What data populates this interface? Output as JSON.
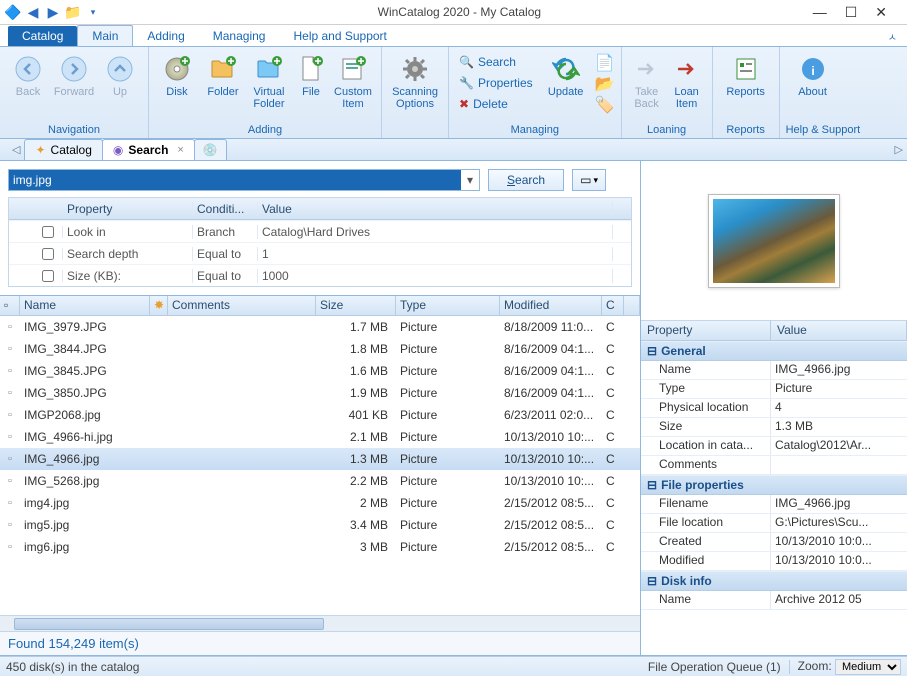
{
  "title": "WinCatalog 2020 - My Catalog",
  "ribbon_tabs": {
    "file": "Catalog",
    "main": "Main",
    "adding": "Adding",
    "managing": "Managing",
    "help": "Help and Support"
  },
  "ribbon": {
    "nav": {
      "back": "Back",
      "forward": "Forward",
      "up": "Up",
      "group": "Navigation"
    },
    "adding": {
      "disk": "Disk",
      "folder": "Folder",
      "vfolder": "Virtual\nFolder",
      "file": "File",
      "custom": "Custom\nItem",
      "group": "Adding"
    },
    "scan": {
      "label": "Scanning\nOptions"
    },
    "managing": {
      "search": "Search",
      "properties": "Properties",
      "delete": "Delete",
      "update": "Update",
      "group": "Managing"
    },
    "loaning": {
      "take": "Take\nBack",
      "loan": "Loan\nItem",
      "group": "Loaning"
    },
    "reports": {
      "label": "Reports",
      "group": "Reports"
    },
    "about": {
      "label": "About",
      "group": "Help & Support"
    }
  },
  "doctabs": {
    "catalog": "Catalog",
    "search": "Search"
  },
  "search": {
    "query": "img.jpg",
    "search_btn": "Search",
    "columns": {
      "property": "Property",
      "condition": "Conditi...",
      "value": "Value"
    },
    "rows": [
      {
        "property": "Look in",
        "condition": "Branch",
        "value": "Catalog\\Hard Drives"
      },
      {
        "property": "Search depth",
        "condition": "Equal to",
        "value": "1"
      },
      {
        "property": "Size (KB):",
        "condition": "Equal to",
        "value": "1000"
      }
    ]
  },
  "results": {
    "columns": {
      "name": "Name",
      "comments": "Comments",
      "size": "Size",
      "type": "Type",
      "modified": "Modified",
      "c": "C"
    },
    "rows": [
      {
        "name": "IMG_3979.JPG",
        "comments": "",
        "size": "1.7 MB",
        "type": "Picture",
        "modified": "8/18/2009 11:0...",
        "c": "C"
      },
      {
        "name": "IMG_3844.JPG",
        "comments": "",
        "size": "1.8 MB",
        "type": "Picture",
        "modified": "8/16/2009 04:1...",
        "c": "C"
      },
      {
        "name": "IMG_3845.JPG",
        "comments": "",
        "size": "1.6 MB",
        "type": "Picture",
        "modified": "8/16/2009 04:1...",
        "c": "C"
      },
      {
        "name": "IMG_3850.JPG",
        "comments": "",
        "size": "1.9 MB",
        "type": "Picture",
        "modified": "8/16/2009 04:1...",
        "c": "C"
      },
      {
        "name": "IMGP2068.jpg",
        "comments": "",
        "size": "401 KB",
        "type": "Picture",
        "modified": "6/23/2011 02:0...",
        "c": "C"
      },
      {
        "name": "IMG_4966-hi.jpg",
        "comments": "",
        "size": "2.1 MB",
        "type": "Picture",
        "modified": "10/13/2010 10:...",
        "c": "C"
      },
      {
        "name": "IMG_4966.jpg",
        "comments": "",
        "size": "1.3 MB",
        "type": "Picture",
        "modified": "10/13/2010 10:...",
        "c": "C",
        "sel": true
      },
      {
        "name": "IMG_5268.jpg",
        "comments": "",
        "size": "2.2 MB",
        "type": "Picture",
        "modified": "10/13/2010 10:...",
        "c": "C"
      },
      {
        "name": "img4.jpg",
        "comments": "",
        "size": "2 MB",
        "type": "Picture",
        "modified": "2/15/2012 08:5...",
        "c": "C"
      },
      {
        "name": "img5.jpg",
        "comments": "",
        "size": "3.4 MB",
        "type": "Picture",
        "modified": "2/15/2012 08:5...",
        "c": "C"
      },
      {
        "name": "img6.jpg",
        "comments": "",
        "size": "3 MB",
        "type": "Picture",
        "modified": "2/15/2012 08:5...",
        "c": "C"
      }
    ],
    "status": "Found 154,249 item(s)"
  },
  "properties": {
    "hdr": {
      "property": "Property",
      "value": "Value"
    },
    "general": {
      "title": "General",
      "rows": [
        {
          "k": "Name",
          "v": "IMG_4966.jpg"
        },
        {
          "k": "Type",
          "v": "Picture"
        },
        {
          "k": "Physical location",
          "v": "4"
        },
        {
          "k": "Size",
          "v": "1.3 MB"
        },
        {
          "k": "Location in cata...",
          "v": "Catalog\\2012\\Ar..."
        },
        {
          "k": "Comments",
          "v": ""
        }
      ]
    },
    "fileprops": {
      "title": "File properties",
      "rows": [
        {
          "k": "Filename",
          "v": "IMG_4966.jpg"
        },
        {
          "k": "File location",
          "v": "G:\\Pictures\\Scu..."
        },
        {
          "k": "Created",
          "v": "10/13/2010 10:0..."
        },
        {
          "k": "Modified",
          "v": "10/13/2010 10:0..."
        }
      ]
    },
    "diskinfo": {
      "title": "Disk info",
      "rows": [
        {
          "k": "Name",
          "v": "Archive 2012 05"
        }
      ]
    }
  },
  "footer": {
    "disks": "450 disk(s) in the catalog",
    "queue": "File Operation Queue (1)",
    "zoom_label": "Zoom:",
    "zoom_value": "Medium"
  }
}
